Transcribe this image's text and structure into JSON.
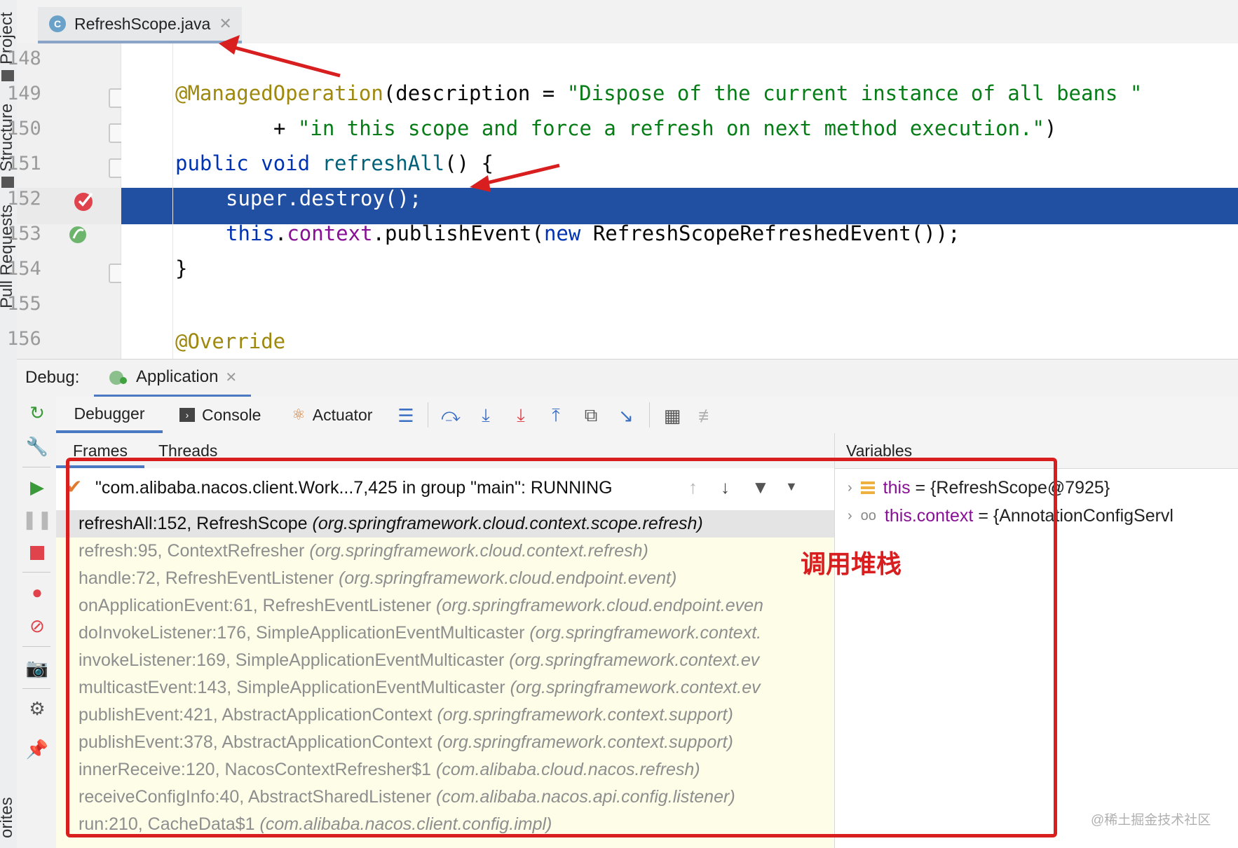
{
  "left_strip": {
    "project": "Project",
    "structure": "Structure",
    "pull_requests": "Pull Requests",
    "favorites": "orites"
  },
  "editor": {
    "tab_label": "RefreshScope.java",
    "tab_icon_letter": "C",
    "line_numbers": [
      "148",
      "149",
      "150",
      "151",
      "152",
      "153",
      "154",
      "155",
      "156"
    ],
    "line149": {
      "annotation": "@ManagedOperation",
      "open": "(description = ",
      "str": "\"Dispose of the current instance of all beans \""
    },
    "line150": {
      "plus": "+ ",
      "str": "\"in this scope and force a refresh on next method execution.\"",
      "close": ")"
    },
    "line151": {
      "kw1": "public",
      "kw2": "void",
      "name": "refreshAll",
      "rest": "() {"
    },
    "line152": {
      "text": "super.destroy();"
    },
    "line153": {
      "kw_this": "this",
      "dot1": ".",
      "field": "context",
      "call": ".publishEvent(",
      "kw_new": "new",
      "rest": " RefreshScopeRefreshedEvent());"
    },
    "line154": {
      "text": "}"
    },
    "line156": {
      "text": "@Override"
    }
  },
  "debug": {
    "label": "Debug:",
    "config_tab": "Application",
    "tabs": {
      "debugger": "Debugger",
      "console": "Console",
      "actuator": "Actuator"
    },
    "frames_header": "Frames",
    "threads_header": "Threads",
    "variables_header": "Variables",
    "thread": "\"com.alibaba.nacos.client.Work...7,425 in group \"main\": RUNNING",
    "frames": [
      {
        "method": "refreshAll:152, RefreshScope",
        "pkg": "(org.springframework.cloud.context.scope.refresh)"
      },
      {
        "method": "refresh:95, ContextRefresher",
        "pkg": "(org.springframework.cloud.context.refresh)"
      },
      {
        "method": "handle:72, RefreshEventListener",
        "pkg": "(org.springframework.cloud.endpoint.event)"
      },
      {
        "method": "onApplicationEvent:61, RefreshEventListener",
        "pkg": "(org.springframework.cloud.endpoint.even"
      },
      {
        "method": "doInvokeListener:176, SimpleApplicationEventMulticaster",
        "pkg": "(org.springframework.context."
      },
      {
        "method": "invokeListener:169, SimpleApplicationEventMulticaster",
        "pkg": "(org.springframework.context.ev"
      },
      {
        "method": "multicastEvent:143, SimpleApplicationEventMulticaster",
        "pkg": "(org.springframework.context.ev"
      },
      {
        "method": "publishEvent:421, AbstractApplicationContext",
        "pkg": "(org.springframework.context.support)"
      },
      {
        "method": "publishEvent:378, AbstractApplicationContext",
        "pkg": "(org.springframework.context.support)"
      },
      {
        "method": "innerReceive:120, NacosContextRefresher$1",
        "pkg": "(com.alibaba.cloud.nacos.refresh)"
      },
      {
        "method": "receiveConfigInfo:40, AbstractSharedListener",
        "pkg": "(com.alibaba.nacos.api.config.listener)"
      },
      {
        "method": "run:210, CacheData$1",
        "pkg": "(com.alibaba.nacos.client.config.impl)"
      }
    ],
    "variables": [
      {
        "name": "this",
        "value": " = {RefreshScope@7925}"
      },
      {
        "name": "this.context",
        "value": " = {AnnotationConfigServl"
      }
    ]
  },
  "annotation_label": "调用堆栈",
  "watermark": "@稀土掘金技术社区",
  "colors": {
    "highlight": "#2150a2",
    "annotation_red": "#d81e1e",
    "frame_bg": "#fdfde8"
  }
}
